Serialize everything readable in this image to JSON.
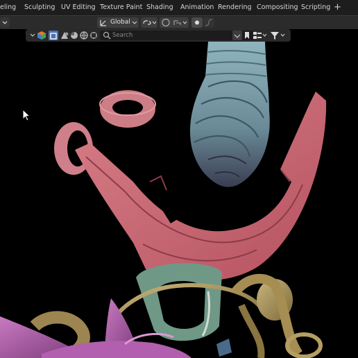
{
  "workspace_tabs": [
    "eling",
    "Sculpting",
    "UV Editing",
    "Texture Paint",
    "Shading",
    "Animation",
    "Rendering",
    "Compositing",
    "Scripting"
  ],
  "add_workspace": "+",
  "header": {
    "orientation": "Global"
  },
  "outliner": {
    "search_placeholder": "Search"
  },
  "icons": [
    "chevron-down-icon",
    "editor-type-icon",
    "chevron-down-icon",
    "link-icon",
    "proportional-edit-icon",
    "snap-icon",
    "collection-icon",
    "object-icon",
    "material-icon",
    "world-icon",
    "search-icon",
    "expand-icon",
    "bookmark-icon",
    "view-options-icon",
    "filter-icon",
    "cursor-icon"
  ],
  "colors": {
    "tab_bar": "#1d1d1d",
    "header": "#2b2b2b",
    "selected_filter": "#4772b3"
  }
}
